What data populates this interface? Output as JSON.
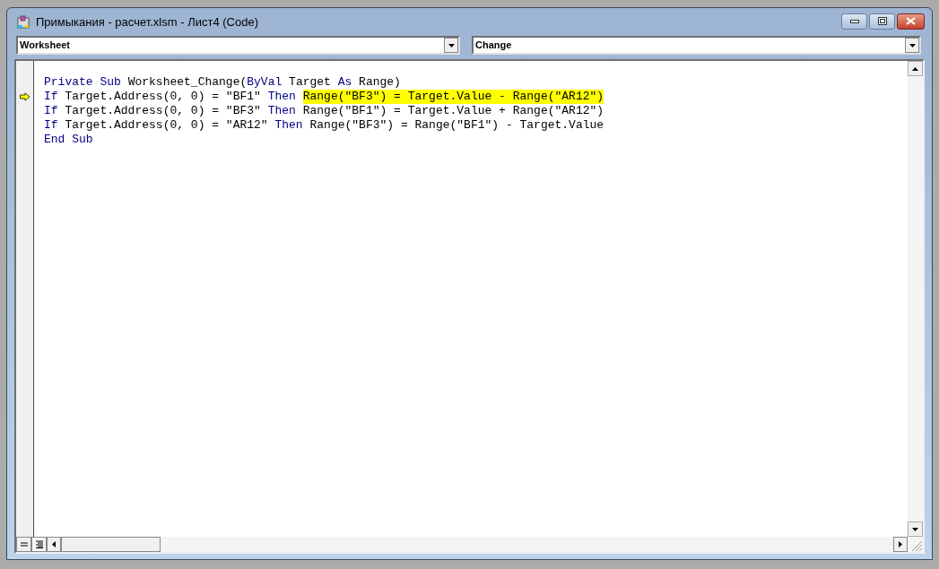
{
  "window": {
    "title": "Примыкания - расчет.xlsm - Лист4 (Code)"
  },
  "object_dropdown": {
    "value": "Worksheet"
  },
  "procedure_dropdown": {
    "value": "Change"
  },
  "code_lines": [
    {
      "current": false,
      "segments": [
        {
          "kind": "keyword",
          "text": "Private Sub",
          "highlighted": false
        },
        {
          "kind": "plain",
          "text": " Worksheet_Change(",
          "highlighted": false
        },
        {
          "kind": "keyword",
          "text": "ByVal",
          "highlighted": false
        },
        {
          "kind": "plain",
          "text": " Target ",
          "highlighted": false
        },
        {
          "kind": "keyword",
          "text": "As",
          "highlighted": false
        },
        {
          "kind": "plain",
          "text": " Range)",
          "highlighted": false
        }
      ]
    },
    {
      "current": true,
      "segments": [
        {
          "kind": "keyword",
          "text": "If",
          "highlighted": false
        },
        {
          "kind": "plain",
          "text": " Target.Address(0, 0) = \"BF1\" ",
          "highlighted": false
        },
        {
          "kind": "keyword",
          "text": "Then ",
          "highlighted": false
        },
        {
          "kind": "plain",
          "text": "Range(\"BF3\") = Target.Value - Range(\"AR12\")",
          "highlighted": true
        }
      ]
    },
    {
      "current": false,
      "segments": [
        {
          "kind": "keyword",
          "text": "If",
          "highlighted": false
        },
        {
          "kind": "plain",
          "text": " Target.Address(0, 0) = \"BF3\" ",
          "highlighted": false
        },
        {
          "kind": "keyword",
          "text": "Then",
          "highlighted": false
        },
        {
          "kind": "plain",
          "text": " Range(\"BF1\") = Target.Value + Range(\"AR12\")",
          "highlighted": false
        }
      ]
    },
    {
      "current": false,
      "segments": [
        {
          "kind": "keyword",
          "text": "If",
          "highlighted": false
        },
        {
          "kind": "plain",
          "text": " Target.Address(0, 0) = \"AR12\" ",
          "highlighted": false
        },
        {
          "kind": "keyword",
          "text": "Then",
          "highlighted": false
        },
        {
          "kind": "plain",
          "text": " Range(\"BF3\") = Range(\"BF1\") - Target.Value",
          "highlighted": false
        }
      ]
    },
    {
      "current": false,
      "segments": [
        {
          "kind": "keyword",
          "text": "End Sub",
          "highlighted": false
        }
      ]
    }
  ]
}
